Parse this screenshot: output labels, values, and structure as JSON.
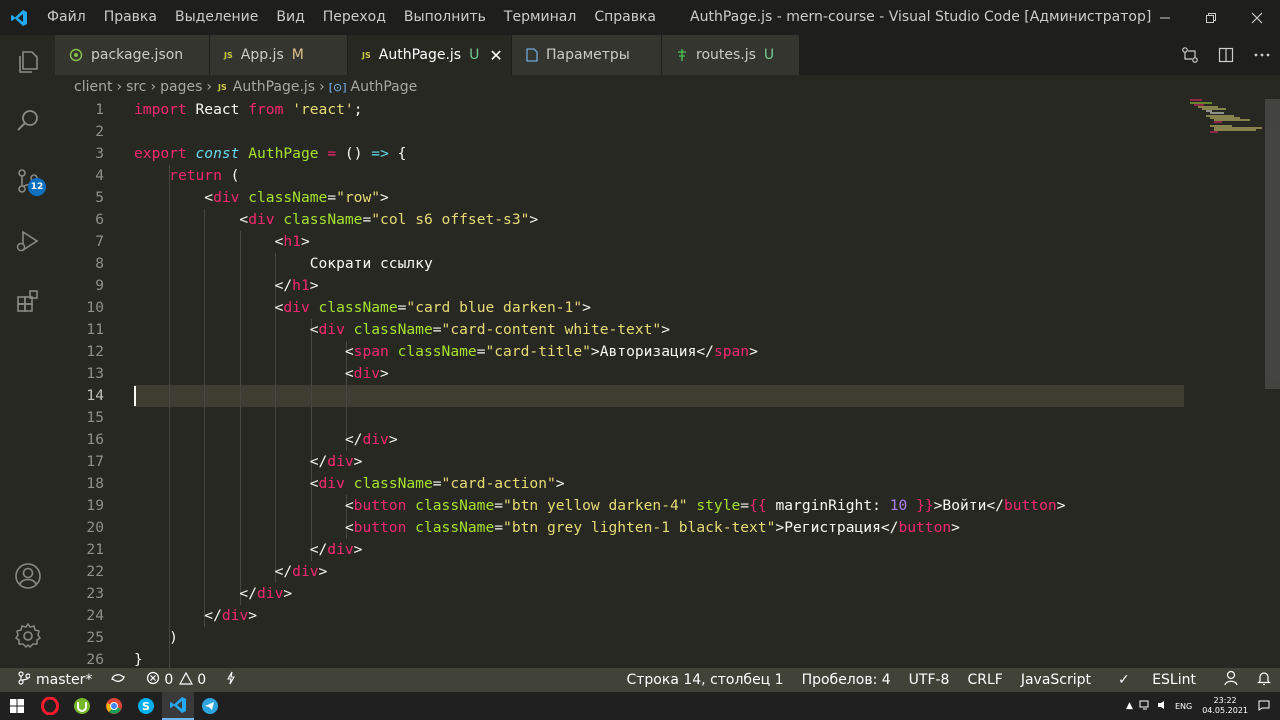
{
  "titlebar": {
    "menu": [
      "Файл",
      "Правка",
      "Выделение",
      "Вид",
      "Переход",
      "Выполнить",
      "Терминал",
      "Справка"
    ],
    "window_title": "AuthPage.js - mern-course - Visual Studio Code [Администратор]"
  },
  "activity_bar": {
    "items": [
      "explorer-icon",
      "search-icon",
      "source-control-icon",
      "run-debug-icon",
      "extensions-icon",
      "accounts-icon",
      "settings-gear-icon"
    ],
    "scm_badge": "12"
  },
  "tabs": [
    {
      "label": "package.json",
      "status": ""
    },
    {
      "label": "App.js",
      "status": "M"
    },
    {
      "label": "AuthPage.js",
      "status": "U",
      "active": true
    },
    {
      "label": "Параметры",
      "status": ""
    },
    {
      "label": "routes.js",
      "status": "U"
    }
  ],
  "breadcrumb": [
    "client",
    "src",
    "pages",
    "AuthPage.js",
    "AuthPage"
  ],
  "editor": {
    "current_line": 14,
    "lines": [
      "import React from 'react';",
      "",
      "export const AuthPage = () => {",
      "    return (",
      "        <div className=\"row\">",
      "            <div className=\"col s6 offset-s3\">",
      "                <h1>",
      "                    Сократи ссылку",
      "                </h1>",
      "                <div className=\"card blue darken-1\">",
      "                    <div className=\"card-content white-text\">",
      "                        <span className=\"card-title\">Авторизация</span>",
      "                        <div>",
      "",
      "",
      "                        </div>",
      "                    </div>",
      "                    <div className=\"card-action\">",
      "                        <button className=\"btn yellow darken-4\" style={{ marginRight: 10 }}>Войти</button>",
      "                        <button className=\"btn grey lighten-1 black-text\">Регистрация</button>",
      "                    </div>",
      "                </div>",
      "            </div>",
      "        </div>",
      "    )",
      "}"
    ]
  },
  "statusbar": {
    "branch": "master*",
    "errors": "0",
    "warnings": "0",
    "position": "Строка 14, столбец 1",
    "indent": "Пробелов: 4",
    "encoding": "UTF-8",
    "eol": "CRLF",
    "language": "JavaScript",
    "linter": "ESLint"
  },
  "taskbar": {
    "lang": "ENG",
    "time": "23:22",
    "date": "04.05.2021"
  }
}
